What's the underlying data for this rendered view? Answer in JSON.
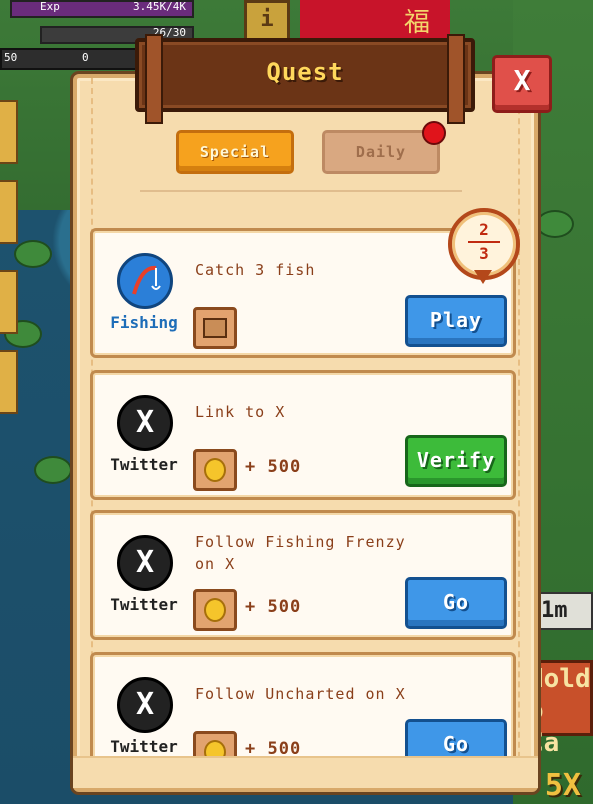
{
  "hud": {
    "exp_label": "Exp",
    "exp_value": "3.45K/4K",
    "energy_value": "26/30",
    "left_value": "50",
    "zero_value": "0",
    "info_label": "i"
  },
  "shrine_char": "福",
  "modal": {
    "title": "Quest",
    "close_label": "X",
    "tabs": {
      "special": "Special",
      "daily": "Daily"
    }
  },
  "quests": [
    {
      "icon": "fishing-rod-icon",
      "label": "Fishing",
      "task": "Catch 3 fish",
      "reward_icon": "chest-icon",
      "reward_amount": "",
      "button": "Play",
      "progress_current": "2",
      "progress_total": "3"
    },
    {
      "icon": "x-logo-icon",
      "label": "Twitter",
      "task": "Link to X",
      "reward_icon": "coin-icon",
      "reward_amount": "+ 500",
      "button": "Verify"
    },
    {
      "icon": "x-logo-icon",
      "label": "Twitter",
      "task": "Follow Fishing Frenzy on X",
      "reward_icon": "coin-icon",
      "reward_amount": "+ 500",
      "button": "Go"
    },
    {
      "icon": "x-logo-icon",
      "label": "Twitter",
      "task": "Follow Uncharted on X",
      "reward_icon": "coin-icon",
      "reward_amount": "+ 500",
      "button": "Go"
    }
  ],
  "side": {
    "timer": "1m",
    "hold_line1": "Hold",
    "hold_line2": "o Ca",
    "multiplier": "5X"
  },
  "colors": {
    "modal_bg": "#f6dcae",
    "title_text": "#ffd85c",
    "button_blue": "#3f97e8",
    "button_green": "#3dbb3a",
    "tab_active": "#f6a21e",
    "close_red": "#e0504a",
    "notification": "#e0141b"
  }
}
